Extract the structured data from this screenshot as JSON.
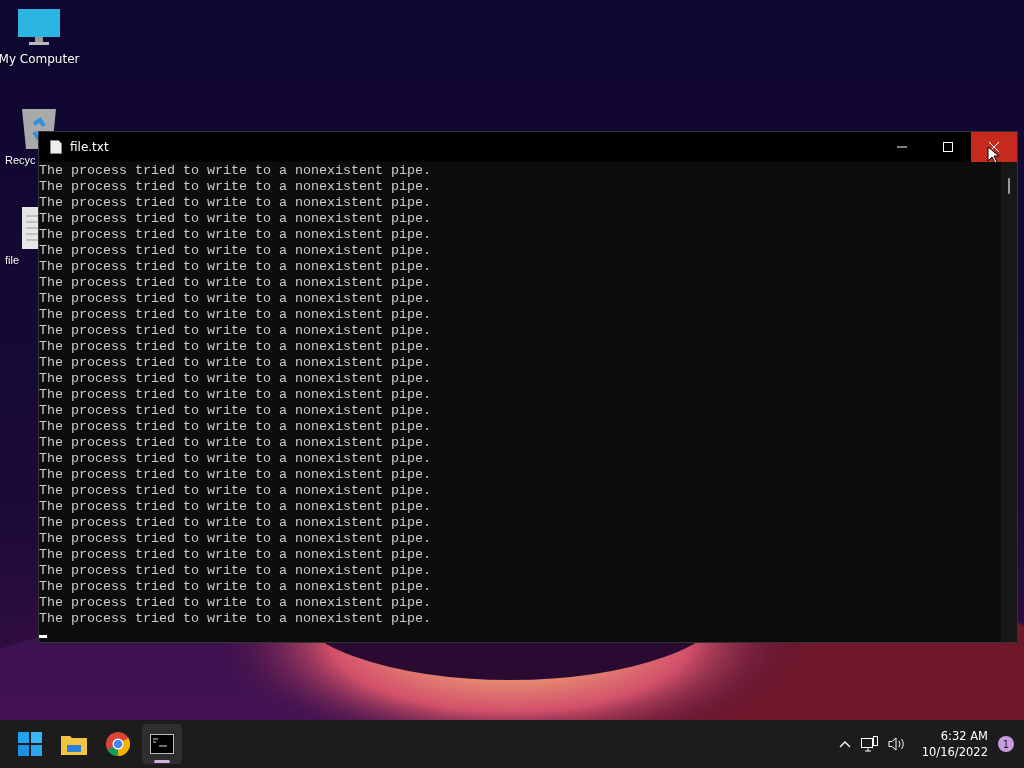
{
  "desktop_icons": [
    {
      "kind": "computer",
      "label": "My Computer"
    },
    {
      "kind": "recycle",
      "label": "Recyc"
    },
    {
      "kind": "document",
      "label": "file"
    }
  ],
  "window": {
    "title": "file.txt",
    "lines": [
      "The process tried to write to a nonexistent pipe.",
      "The process tried to write to a nonexistent pipe.",
      "The process tried to write to a nonexistent pipe.",
      "The process tried to write to a nonexistent pipe.",
      "The process tried to write to a nonexistent pipe.",
      "The process tried to write to a nonexistent pipe.",
      "The process tried to write to a nonexistent pipe.",
      "The process tried to write to a nonexistent pipe.",
      "The process tried to write to a nonexistent pipe.",
      "The process tried to write to a nonexistent pipe.",
      "The process tried to write to a nonexistent pipe.",
      "The process tried to write to a nonexistent pipe.",
      "The process tried to write to a nonexistent pipe.",
      "The process tried to write to a nonexistent pipe.",
      "The process tried to write to a nonexistent pipe.",
      "The process tried to write to a nonexistent pipe.",
      "The process tried to write to a nonexistent pipe.",
      "The process tried to write to a nonexistent pipe.",
      "The process tried to write to a nonexistent pipe.",
      "The process tried to write to a nonexistent pipe.",
      "The process tried to write to a nonexistent pipe.",
      "The process tried to write to a nonexistent pipe.",
      "The process tried to write to a nonexistent pipe.",
      "The process tried to write to a nonexistent pipe.",
      "The process tried to write to a nonexistent pipe.",
      "The process tried to write to a nonexistent pipe.",
      "The process tried to write to a nonexistent pipe.",
      "The process tried to write to a nonexistent pipe.",
      "The process tried to write to a nonexistent pipe."
    ]
  },
  "taskbar": {
    "apps": [
      {
        "kind": "start",
        "selected": false
      },
      {
        "kind": "folder",
        "selected": false
      },
      {
        "kind": "browser",
        "selected": false
      },
      {
        "kind": "terminal",
        "selected": true
      }
    ],
    "time": "6:32 AM",
    "date": "10/16/2022",
    "notifications": "1"
  }
}
